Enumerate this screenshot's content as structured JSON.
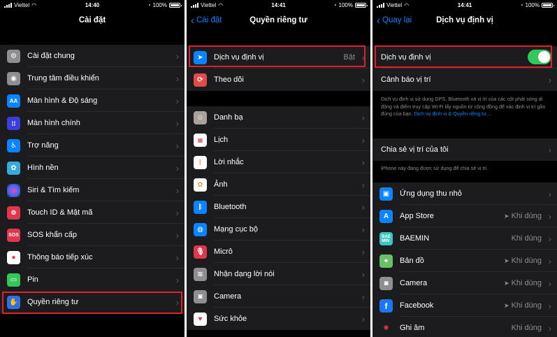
{
  "status": {
    "carrier": "Viettel",
    "battery": "100%",
    "times": [
      "14:40",
      "14:41",
      "14:41"
    ]
  },
  "screen1": {
    "title": "Cài đặt",
    "items": [
      {
        "label": "Cài đặt chung",
        "icon": "gear-icon",
        "color": "#8e8e93"
      },
      {
        "label": "Trung tâm điều khiển",
        "icon": "control-center-icon",
        "color": "#8e8e93"
      },
      {
        "label": "Màn hình & Độ sáng",
        "icon": "display-brightness-icon",
        "color": "#0a84ff"
      },
      {
        "label": "Màn hình chính",
        "icon": "home-screen-icon",
        "color": "#3a3fd9"
      },
      {
        "label": "Trợ năng",
        "icon": "accessibility-icon",
        "color": "#0a84ff"
      },
      {
        "label": "Hình nền",
        "icon": "wallpaper-icon",
        "color": "#35aadc"
      },
      {
        "label": "Siri & Tìm kiếm",
        "icon": "siri-icon",
        "color": "#222"
      },
      {
        "label": "Touch ID & Mật mã",
        "icon": "fingerprint-icon",
        "color": "#e0364e"
      },
      {
        "label": "SOS khẩn cấp",
        "icon": "sos-icon",
        "color": "#e0364e"
      },
      {
        "label": "Thông báo tiếp xúc",
        "icon": "exposure-icon",
        "color": "#fff"
      },
      {
        "label": "Pin",
        "icon": "battery-icon",
        "color": "#34c759"
      },
      {
        "label": "Quyền riêng tư",
        "icon": "hand-icon",
        "color": "#2f6fe0"
      }
    ]
  },
  "screen2": {
    "back": "Cài đặt",
    "title": "Quyền riêng tư",
    "location": {
      "label": "Dịch vụ định vị",
      "value": "Bật"
    },
    "tracking": {
      "label": "Theo dõi"
    },
    "items": [
      {
        "label": "Danh bạ",
        "icon": "contacts-icon",
        "color": "#a8a29a"
      },
      {
        "label": "Lịch",
        "icon": "calendar-icon",
        "color": "#ffffff"
      },
      {
        "label": "Lời nhắc",
        "icon": "reminders-icon",
        "color": "#ffffff"
      },
      {
        "label": "Ảnh",
        "icon": "photos-icon",
        "color": "#ffffff"
      },
      {
        "label": "Bluetooth",
        "icon": "bluetooth-icon",
        "color": "#0a84ff"
      },
      {
        "label": "Mạng cục bộ",
        "icon": "globe-icon",
        "color": "#0a84ff"
      },
      {
        "label": "Micrô",
        "icon": "microphone-icon",
        "color": "#e0364e"
      },
      {
        "label": "Nhận dạng lời nói",
        "icon": "waveform-icon",
        "color": "#8e8e93"
      },
      {
        "label": "Camera",
        "icon": "camera-icon",
        "color": "#8e8e93"
      },
      {
        "label": "Sức khỏe",
        "icon": "heart-icon",
        "color": "#ffffff"
      }
    ]
  },
  "screen3": {
    "back": "Quay lại",
    "title": "Dịch vụ định vị",
    "toggle_label": "Dịch vụ định vị",
    "alerts_label": "Cảnh báo vị trí",
    "description": "Dịch vụ định vị sử dụng GPS, Bluetooth và vị trí của các cột phát sóng di động và điểm truy cập Wi-Fi lấy nguồn từ cộng đồng để xác định vị trí gần đúng của bạn.",
    "description_link": "Dịch vụ định vị & Quyền riêng tư…",
    "share_label": "Chia sẻ vị trí của tôi",
    "share_note": "iPhone này đang được sử dụng để chia sẻ vị trí.",
    "apps": [
      {
        "label": "Ứng dụng thu nhỏ",
        "icon": "app-clips-icon",
        "color": "#0a84ff",
        "value": ""
      },
      {
        "label": "App Store",
        "icon": "app-store-icon",
        "color": "#0a84ff",
        "value": "Khi dùng"
      },
      {
        "label": "BAEMIN",
        "icon": "baemin-icon",
        "color": "#3cc5c0",
        "value": "Khi dùng"
      },
      {
        "label": "Bản đồ",
        "icon": "maps-icon",
        "color": "#6abf69",
        "value": "Khi dùng"
      },
      {
        "label": "Camera",
        "icon": "camera-icon",
        "color": "#8e8e93",
        "value": "Khi dùng"
      },
      {
        "label": "Facebook",
        "icon": "facebook-icon",
        "color": "#1877f2",
        "value": "Khi dùng"
      },
      {
        "label": "Ghi âm",
        "icon": "voice-memos-icon",
        "color": "#1c1c1e",
        "value": "Khi dùng"
      }
    ]
  }
}
